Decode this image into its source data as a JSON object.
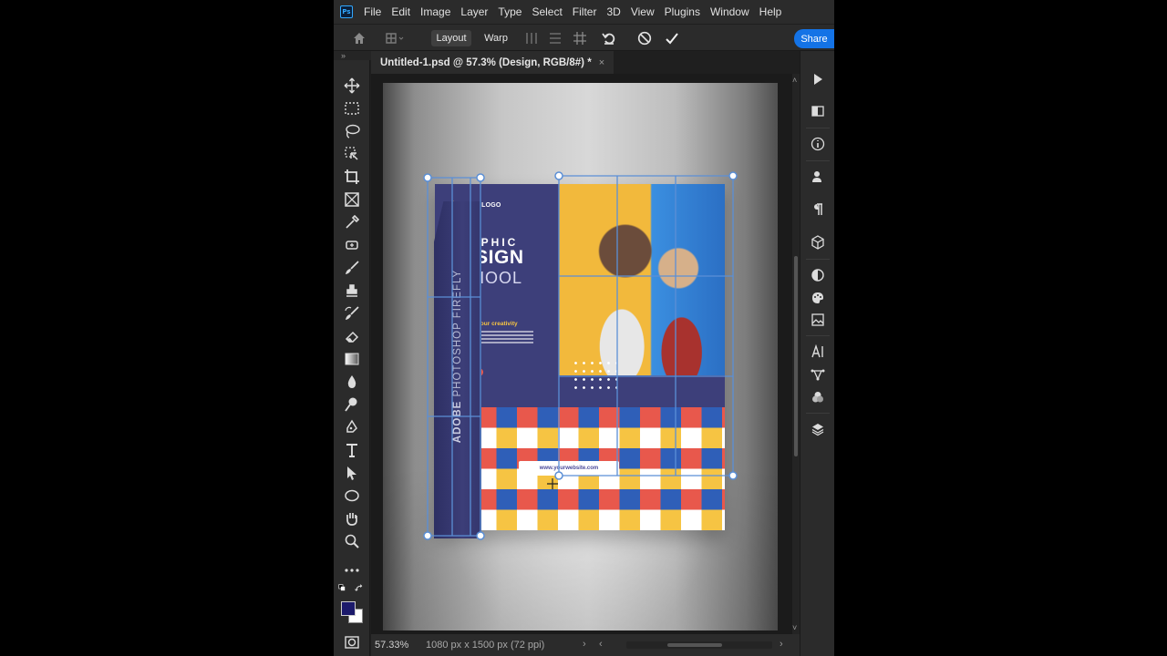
{
  "app": {
    "logo_text": "Ps"
  },
  "menu": [
    "File",
    "Edit",
    "Image",
    "Layer",
    "Type",
    "Select",
    "Filter",
    "3D",
    "View",
    "Plugins",
    "Window",
    "Help"
  ],
  "options_bar": {
    "mode_layout": "Layout",
    "mode_warp": "Warp",
    "active_mode": "Layout",
    "share_label": "Share"
  },
  "document": {
    "tab_title": "Untitled-1.psd @ 57.3% (Design, RGB/8#) *",
    "close_glyph": "×"
  },
  "flyer": {
    "logo": "YOUR LOGO",
    "title_line1": "GRAPHIC",
    "title_line2": "DESIGN",
    "title_line3": "SCHOOL",
    "tagline": "Invest in your creativity",
    "website": "www.yourwebsite.com",
    "flap_bold": "ADOBE",
    "flap_text": " PHOTOSHOP FIREFLY"
  },
  "status": {
    "zoom": "57.33%",
    "doc_info": "1080 px x 1500 px (72 ppi)",
    "arrow": "›"
  },
  "colors": {
    "accent": "#1473e6",
    "flyer_navy": "#3d3f7a",
    "flyer_yellow": "#f6c443",
    "flyer_red": "#e8584c",
    "flyer_blue": "#2f5fb8",
    "warp_handle": "#5b8fd6",
    "foreground_swatch": "#1c1a6b",
    "background_swatch": "#ffffff"
  },
  "icons": {
    "toolbar": [
      "move-icon",
      "marquee-icon",
      "lasso-icon",
      "object-select-icon",
      "crop-icon",
      "frame-icon",
      "eyedropper-icon",
      "healing-icon",
      "brush-icon",
      "stamp-icon",
      "history-brush-icon",
      "eraser-icon",
      "gradient-icon",
      "blur-icon",
      "dodge-icon",
      "pen-icon",
      "type-icon",
      "path-select-icon",
      "ellipse-icon",
      "hand-icon",
      "zoom-icon",
      "more-icon"
    ],
    "rightbar": [
      "play-icon",
      "swatches-icon",
      "info-icon",
      "character-icon",
      "paragraph-icon",
      "3d-icon",
      "adjustments-icon",
      "color-icon",
      "image-icon",
      "glyphs-icon",
      "paths-icon",
      "channels-icon",
      "layers-icon"
    ]
  }
}
